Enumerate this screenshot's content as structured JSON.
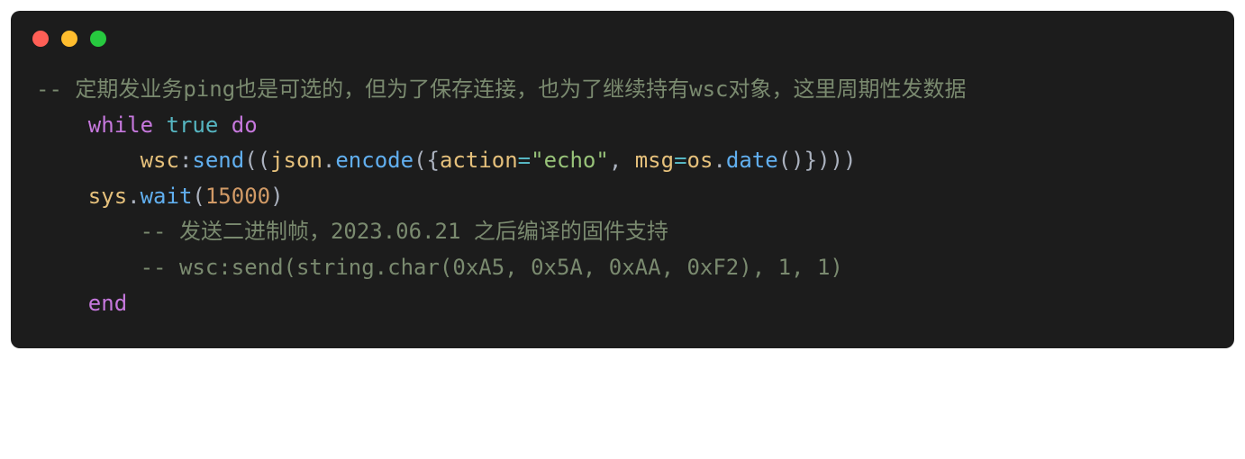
{
  "window": {
    "dots": [
      "red",
      "yellow",
      "green"
    ]
  },
  "code": {
    "line1_comment_prefix": "-- ",
    "line1_comment_text": "定期发业务ping也是可选的，但为了保存连接，也为了继续持有wsc对象，这里周期性发数据",
    "indent1": "    ",
    "indent2": "        ",
    "kw_while": "while",
    "kw_true": "true",
    "kw_do": "do",
    "kw_end": "end",
    "space": " ",
    "wsc": "wsc",
    "colon": ":",
    "send": "send",
    "lparen": "(",
    "rparen": ")",
    "lbrace": "{",
    "rbrace": "}",
    "json": "json",
    "dot": ".",
    "encode": "encode",
    "action": "action",
    "eq": "=",
    "str_echo": "\"echo\"",
    "comma": ",",
    "msg": "msg",
    "os": "os",
    "date": "date",
    "sys": "sys",
    "wait": "wait",
    "num_15000": "15000",
    "line5_comment": "-- 发送二进制帧，2023.06.21 之后编译的固件支持",
    "line6_comment": "-- wsc:send(string.char(0xA5, 0x5A, 0xAA, 0xF2), 1, 1)"
  }
}
